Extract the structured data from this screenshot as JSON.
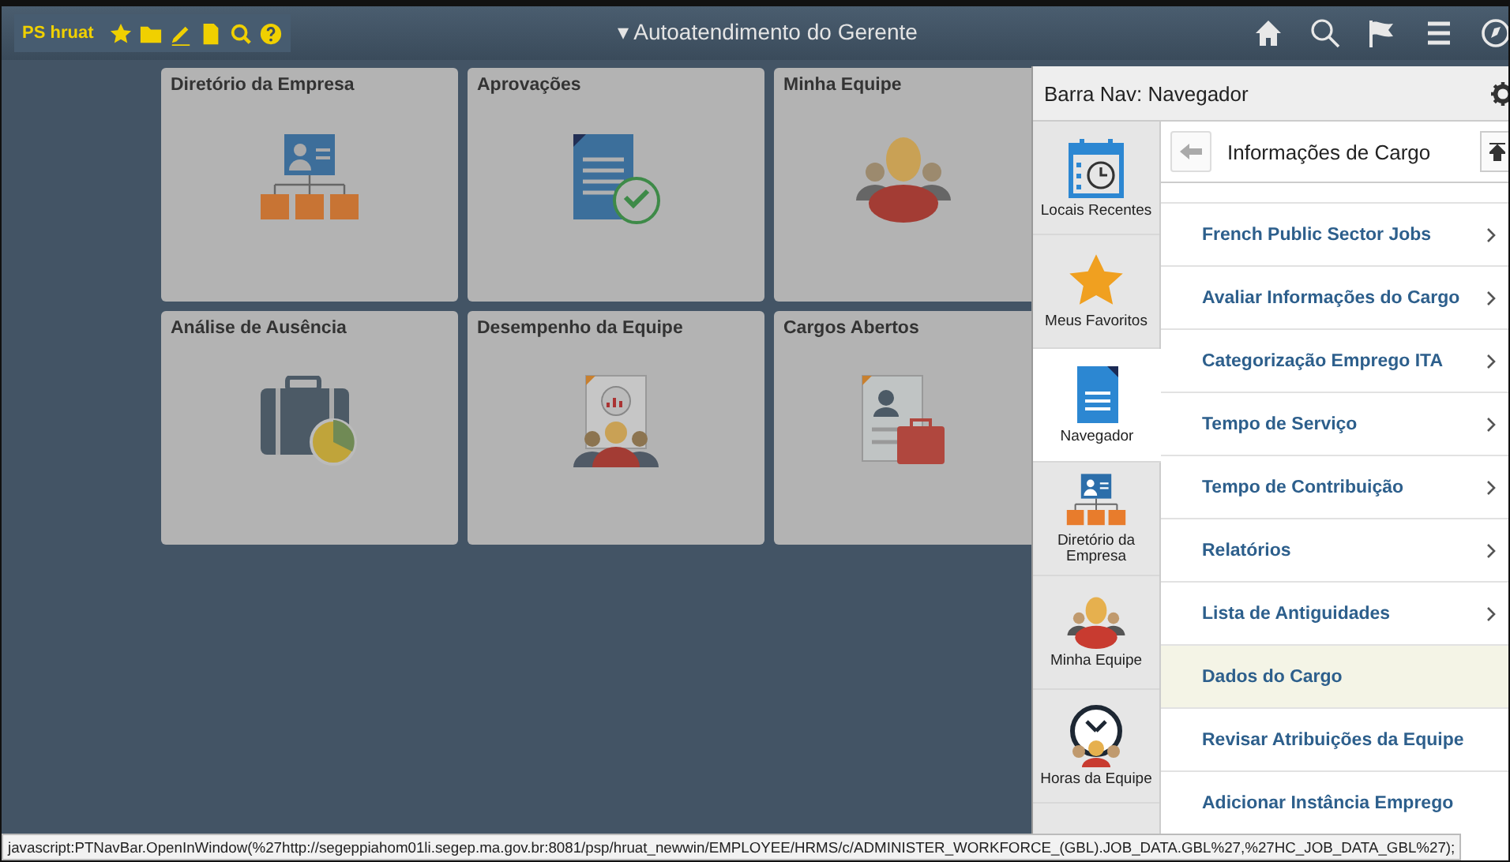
{
  "header": {
    "toolbar_label": "PS hruat",
    "title_caret": "▾",
    "title": "Autoatendimento do Gerente"
  },
  "tiles": [
    {
      "title": "Diretório da Empresa",
      "kind": "directory"
    },
    {
      "title": "Aprovações",
      "kind": "approvals"
    },
    {
      "title": "Minha Equipe",
      "kind": "team"
    },
    {
      "title": "Análise de Ausência",
      "kind": "absence"
    },
    {
      "title": "Desempenho da Equipe",
      "kind": "performance"
    },
    {
      "title": "Cargos Abertos",
      "kind": "jobs"
    }
  ],
  "nav_panel": {
    "title": "Barra Nav: Navegador",
    "breadcrumb": "Informações de Cargo",
    "sidebar": [
      {
        "label": "Locais Recentes",
        "kind": "recent",
        "selected": false
      },
      {
        "label": "Meus Favoritos",
        "kind": "favorites",
        "selected": false
      },
      {
        "label": "Navegador",
        "kind": "navigator",
        "selected": true
      },
      {
        "label": "Diretório da Empresa",
        "kind": "directory",
        "selected": false
      },
      {
        "label": "Minha Equipe",
        "kind": "team",
        "selected": false
      },
      {
        "label": "Horas da Equipe",
        "kind": "time",
        "selected": false
      }
    ],
    "items": [
      {
        "label": "French Public Sector Jobs",
        "has_children": true,
        "selected": false
      },
      {
        "label": "Avaliar Informações do Cargo",
        "has_children": true,
        "selected": false
      },
      {
        "label": "Categorização Emprego ITA",
        "has_children": true,
        "selected": false
      },
      {
        "label": "Tempo de Serviço",
        "has_children": true,
        "selected": false
      },
      {
        "label": "Tempo de Contribuição",
        "has_children": true,
        "selected": false
      },
      {
        "label": "Relatórios",
        "has_children": true,
        "selected": false
      },
      {
        "label": "Lista de Antiguidades",
        "has_children": true,
        "selected": false
      },
      {
        "label": "Dados do Cargo",
        "has_children": false,
        "selected": true
      },
      {
        "label": "Revisar Atribuições da Equipe",
        "has_children": false,
        "selected": false
      },
      {
        "label": "Adicionar Instância Emprego",
        "has_children": false,
        "selected": false
      }
    ]
  },
  "status_bar": "javascript:PTNavBar.OpenInWindow(%27http://segeppiahom01li.segep.ma.gov.br:8081/psp/hruat_newwin/EMPLOYEE/HRMS/c/ADMINISTER_WORKFORCE_(GBL).JOB_DATA.GBL%27,%27HC_JOB_DATA_GBL%27);"
}
